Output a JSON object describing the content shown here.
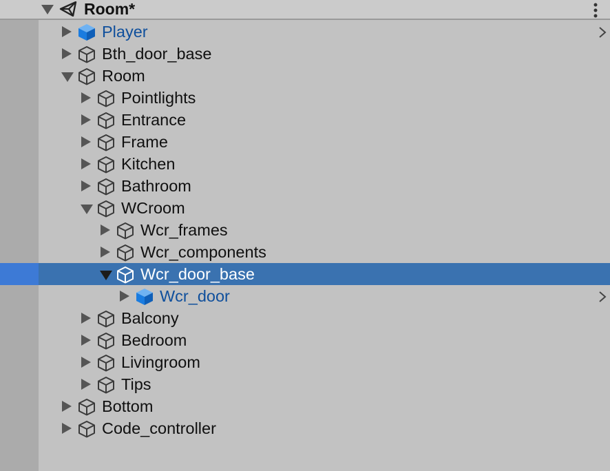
{
  "header": {
    "title": "Room*",
    "scene_icon": "unity-scene-icon",
    "menu_icon": "kebab-menu-icon"
  },
  "colors": {
    "prefab_text": "#0f4f9c",
    "prefab_cube": "#1a7ce0",
    "selection": "#3a72b0",
    "background": "#c2c2c2"
  },
  "hierarchy": [
    {
      "label": "Player",
      "depth": 0,
      "expanded": false,
      "prefab": true,
      "has_chevron": true,
      "selected": false
    },
    {
      "label": "Bth_door_base",
      "depth": 0,
      "expanded": false,
      "prefab": false,
      "has_chevron": false,
      "selected": false
    },
    {
      "label": "Room",
      "depth": 0,
      "expanded": true,
      "prefab": false,
      "has_chevron": false,
      "selected": false
    },
    {
      "label": "Pointlights",
      "depth": 1,
      "expanded": false,
      "prefab": false,
      "has_chevron": false,
      "selected": false
    },
    {
      "label": "Entrance",
      "depth": 1,
      "expanded": false,
      "prefab": false,
      "has_chevron": false,
      "selected": false
    },
    {
      "label": "Frame",
      "depth": 1,
      "expanded": false,
      "prefab": false,
      "has_chevron": false,
      "selected": false
    },
    {
      "label": "Kitchen",
      "depth": 1,
      "expanded": false,
      "prefab": false,
      "has_chevron": false,
      "selected": false
    },
    {
      "label": "Bathroom",
      "depth": 1,
      "expanded": false,
      "prefab": false,
      "has_chevron": false,
      "selected": false
    },
    {
      "label": "WCroom",
      "depth": 1,
      "expanded": true,
      "prefab": false,
      "has_chevron": false,
      "selected": false
    },
    {
      "label": "Wcr_frames",
      "depth": 2,
      "expanded": false,
      "prefab": false,
      "has_chevron": false,
      "selected": false
    },
    {
      "label": "Wcr_components",
      "depth": 2,
      "expanded": false,
      "prefab": false,
      "has_chevron": false,
      "selected": false
    },
    {
      "label": "Wcr_door_base",
      "depth": 2,
      "expanded": true,
      "prefab": false,
      "has_chevron": false,
      "selected": true
    },
    {
      "label": "Wcr_door",
      "depth": 3,
      "expanded": false,
      "prefab": true,
      "has_chevron": true,
      "selected": false
    },
    {
      "label": "Balcony",
      "depth": 1,
      "expanded": false,
      "prefab": false,
      "has_chevron": false,
      "selected": false
    },
    {
      "label": "Bedroom",
      "depth": 1,
      "expanded": false,
      "prefab": false,
      "has_chevron": false,
      "selected": false
    },
    {
      "label": "Livingroom",
      "depth": 1,
      "expanded": false,
      "prefab": false,
      "has_chevron": false,
      "selected": false
    },
    {
      "label": "Tips",
      "depth": 1,
      "expanded": false,
      "prefab": false,
      "has_chevron": false,
      "selected": false
    },
    {
      "label": "Bottom",
      "depth": 0,
      "expanded": false,
      "prefab": false,
      "has_chevron": false,
      "selected": false
    },
    {
      "label": "Code_controller",
      "depth": 0,
      "expanded": false,
      "prefab": false,
      "has_chevron": false,
      "selected": false
    }
  ]
}
